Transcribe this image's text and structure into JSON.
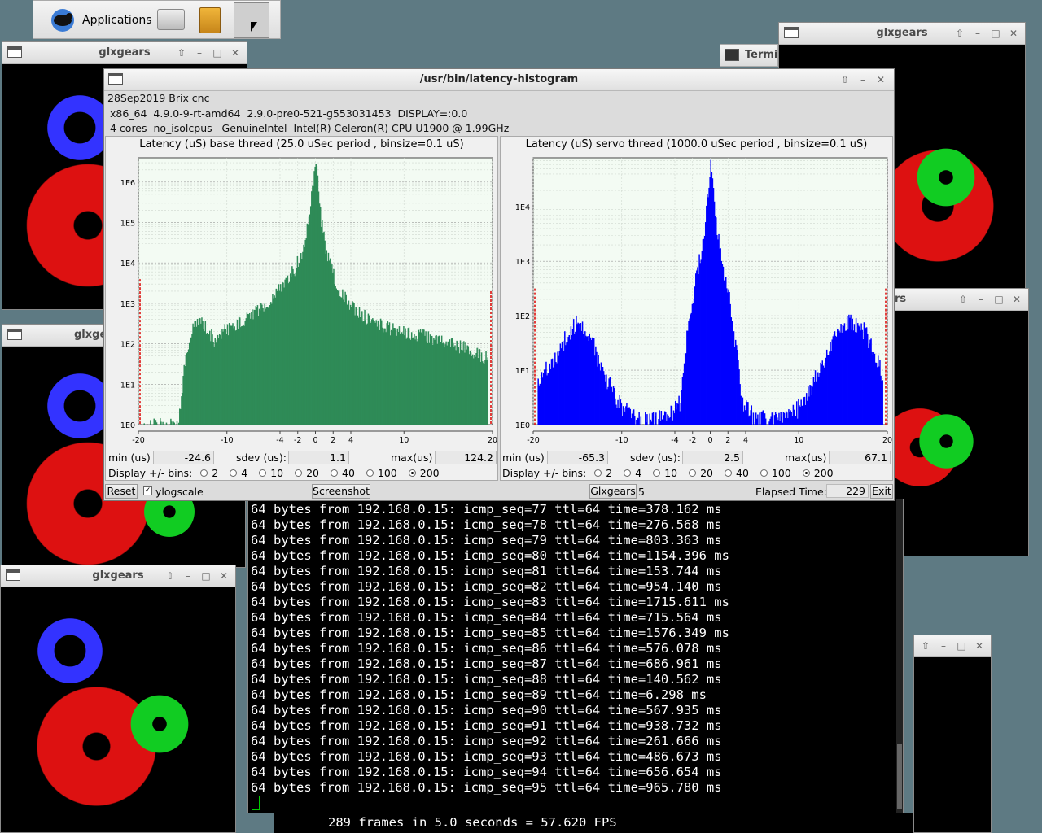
{
  "panel": {
    "applications_label": "Applications"
  },
  "glxgears_windows": [
    {
      "title": "glxgears"
    },
    {
      "title": "glxgears"
    },
    {
      "title": "glxgears"
    },
    {
      "title": "glxgears"
    }
  ],
  "background_windows": {
    "terminal_tab_label": "Termi",
    "right_partial_title": "rs"
  },
  "latency": {
    "title": "/usr/bin/latency-histogram",
    "info_line1": "28Sep2019 Brix cnc",
    "info_line2": "x86_64  4.9.0-9-rt-amd64  2.9.0-pre0-521-g553031453  DISPLAY=:0.0",
    "info_line3": "4 cores  no_isolcpus   GenuineIntel  Intel(R) Celeron(R) CPU U1900 @ 1.99GHz",
    "base": {
      "title": "Latency (uS) base thread (25.0 uSec period , binsize=0.1 uS)",
      "min_label": "min (us)",
      "min_value": "-24.6",
      "sdev_label": "sdev (us):",
      "sdev_value": "1.1",
      "max_label": "max(us)",
      "max_value": "124.2",
      "color": "#2e8b57"
    },
    "servo": {
      "title": "Latency (uS) servo thread (1000.0 uSec period , binsize=0.1 uS)",
      "min_label": "min (us)",
      "min_value": "-65.3",
      "sdev_label": "sdev (us):",
      "sdev_value": "2.5",
      "max_label": "max(us)",
      "max_value": "67.1",
      "color": "#0000ff"
    },
    "bins_label": "Display +/- bins:",
    "bin_options": [
      "2",
      "4",
      "10",
      "20",
      "40",
      "100",
      "200"
    ],
    "bin_selected": "200",
    "reset_label": "Reset",
    "ylog_label": "ylogscale",
    "screenshot_label": "Screenshot",
    "glxgears_label": "Glxgears",
    "glxgears_count": "5",
    "elapsed_label": "Elapsed Time:",
    "elapsed_value": "229",
    "exit_label": "Exit"
  },
  "chart_data": [
    {
      "type": "bar",
      "title": "Latency (uS) base thread (25.0 uSec period , binsize=0.1 uS)",
      "x_ticks": [
        "-20",
        "-10",
        "-4",
        "-2",
        "0",
        "2",
        "4",
        "10",
        "20"
      ],
      "x_tick_values": [
        -20,
        -10,
        -4,
        -2,
        0,
        2,
        4,
        10,
        20
      ],
      "y_ticks": [
        "1E0",
        "1E1",
        "1E2",
        "1E3",
        "1E4",
        "1E5",
        "1E6"
      ],
      "y_scale": "log",
      "xlim": [
        -20,
        20
      ],
      "ylim_log10": [
        0,
        6.6
      ],
      "grid": true,
      "profile": {
        "x": [
          -20,
          -15.5,
          -14.8,
          -14,
          -13,
          -12.5,
          -11.5,
          -10.5,
          -9.5,
          -8,
          -6,
          -4,
          -2.5,
          -1.5,
          -1,
          -0.5,
          -0.2,
          0,
          0.2,
          0.5,
          1,
          1.5,
          2.5,
          4,
          6,
          8,
          10,
          14,
          18,
          19.5,
          20
        ],
        "log10_count": [
          0,
          0,
          1.6,
          2.4,
          2.6,
          2.4,
          2.1,
          2.3,
          2.4,
          2.6,
          2.9,
          3.4,
          3.8,
          4.3,
          4.9,
          5.6,
          6.3,
          6.6,
          6.0,
          5.2,
          4.5,
          4.0,
          3.4,
          2.9,
          2.6,
          2.4,
          2.3,
          2.1,
          1.8,
          1.6,
          1.5
        ]
      },
      "edge_markers": {
        "left_log10": 3.6,
        "right_log10": 3.3
      }
    },
    {
      "type": "bar",
      "title": "Latency (uS) servo thread (1000.0 uSec period , binsize=0.1 uS)",
      "x_ticks": [
        "-20",
        "-10",
        "-4",
        "-2",
        "0",
        "2",
        "4",
        "10",
        "20"
      ],
      "x_tick_values": [
        -20,
        -10,
        -4,
        -2,
        0,
        2,
        4,
        10,
        20
      ],
      "y_ticks": [
        "1E0",
        "1E1",
        "1E2",
        "1E3",
        "1E4"
      ],
      "y_scale": "log",
      "xlim": [
        -20,
        20
      ],
      "ylim_log10": [
        0,
        4.9
      ],
      "grid": true,
      "profile": {
        "x": [
          -20,
          -19,
          -18,
          -17,
          -16,
          -15,
          -14.5,
          -13.5,
          -13,
          -12,
          -11,
          -10,
          -8,
          -5,
          -3.5,
          -3,
          -2,
          -1,
          -0.5,
          0,
          0.5,
          1,
          2,
          3,
          3.5,
          5,
          8,
          10,
          11,
          12,
          13,
          14,
          15,
          16,
          17,
          18,
          19,
          20
        ],
        "log10_count": [
          0.6,
          0.9,
          1.1,
          1.4,
          1.7,
          1.9,
          1.8,
          1.6,
          1.3,
          0.9,
          0.6,
          0.3,
          0.1,
          0.1,
          0.4,
          1.2,
          2.4,
          3.2,
          3.9,
          4.9,
          3.9,
          3.2,
          2.4,
          1.2,
          0.4,
          0.1,
          0.1,
          0.3,
          0.6,
          0.9,
          1.3,
          1.6,
          1.8,
          1.9,
          1.8,
          1.5,
          1.1,
          0.7
        ]
      },
      "edge_markers": {
        "left_log10": 2.5,
        "right_log10": 2.5
      }
    }
  ],
  "terminal": {
    "lines": [
      "64 bytes from 192.168.0.15: icmp_seq=77 ttl=64 time=378.162 ms",
      "64 bytes from 192.168.0.15: icmp_seq=78 ttl=64 time=276.568 ms",
      "64 bytes from 192.168.0.15: icmp_seq=79 ttl=64 time=803.363 ms",
      "64 bytes from 192.168.0.15: icmp_seq=80 ttl=64 time=1154.396 ms",
      "64 bytes from 192.168.0.15: icmp_seq=81 ttl=64 time=153.744 ms",
      "64 bytes from 192.168.0.15: icmp_seq=82 ttl=64 time=954.140 ms",
      "64 bytes from 192.168.0.15: icmp_seq=83 ttl=64 time=1715.611 ms",
      "64 bytes from 192.168.0.15: icmp_seq=84 ttl=64 time=715.564 ms",
      "64 bytes from 192.168.0.15: icmp_seq=85 ttl=64 time=1576.349 ms",
      "64 bytes from 192.168.0.15: icmp_seq=86 ttl=64 time=576.078 ms",
      "64 bytes from 192.168.0.15: icmp_seq=87 ttl=64 time=686.961 ms",
      "64 bytes from 192.168.0.15: icmp_seq=88 ttl=64 time=140.562 ms",
      "64 bytes from 192.168.0.15: icmp_seq=89 ttl=64 time=6.298 ms",
      "64 bytes from 192.168.0.15: icmp_seq=90 ttl=64 time=567.935 ms",
      "64 bytes from 192.168.0.15: icmp_seq=91 ttl=64 time=938.732 ms",
      "64 bytes from 192.168.0.15: icmp_seq=92 ttl=64 time=261.666 ms",
      "64 bytes from 192.168.0.15: icmp_seq=93 ttl=64 time=486.673 ms",
      "64 bytes from 192.168.0.15: icmp_seq=94 ttl=64 time=656.654 ms",
      "64 bytes from 192.168.0.15: icmp_seq=95 ttl=64 time=965.780 ms"
    ],
    "fps_line": "289 frames in 5.0 seconds = 57.620 FPS"
  }
}
